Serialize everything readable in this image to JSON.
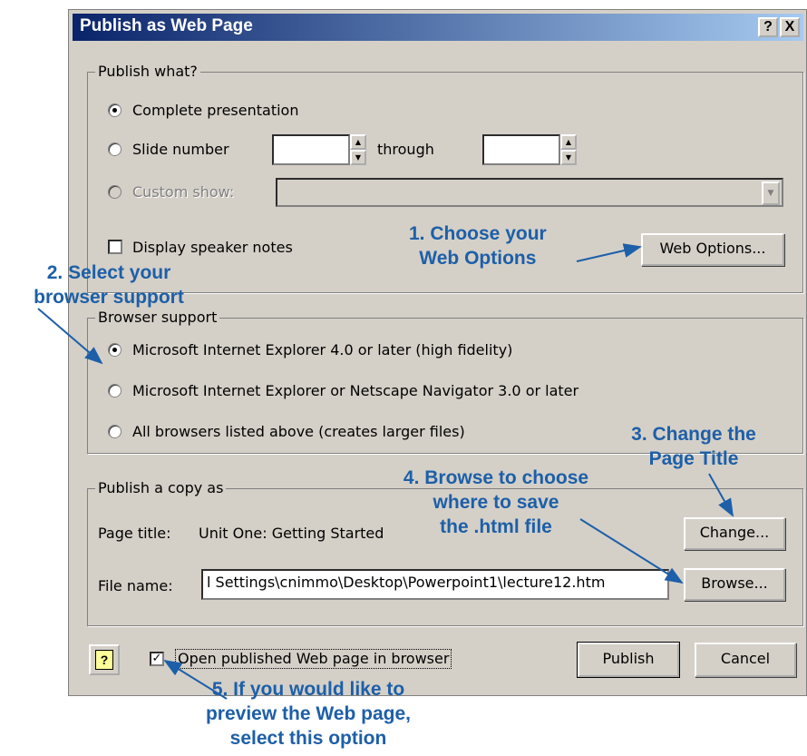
{
  "dialog": {
    "title": "Publish as Web Page",
    "help_button": "?",
    "close_button": "X"
  },
  "publish_what": {
    "legend": "Publish what?",
    "complete_presentation": "Complete presentation",
    "slide_number": "Slide number",
    "slide_from_value": "",
    "through": "through",
    "slide_to_value": "",
    "custom_show": "Custom show:",
    "custom_show_value": "",
    "display_speaker_notes": "Display speaker notes",
    "web_options_button": "Web Options..."
  },
  "browser_support": {
    "legend": "Browser support",
    "option_ie4": "Microsoft Internet Explorer 4.0 or later (high fidelity)",
    "option_ie_netscape": "Microsoft Internet Explorer or Netscape Navigator 3.0 or later",
    "option_all": "All browsers listed above (creates larger files)",
    "selected": "option_ie4"
  },
  "publish_copy": {
    "legend": "Publish a copy as",
    "page_title_label": "Page title:",
    "page_title_value": "Unit One: Getting Started",
    "change_button": "Change...",
    "file_name_label": "File name:",
    "file_name_value": "l Settings\\cnimmo\\Desktop\\Powerpoint1\\lecture12.htm",
    "browse_button": "Browse..."
  },
  "footer": {
    "open_in_browser": "Open published Web page in browser",
    "open_in_browser_checked": true,
    "publish_button": "Publish",
    "cancel_button": "Cancel"
  },
  "annotations": {
    "step1": [
      "1. Choose your",
      "Web Options"
    ],
    "step2": [
      "2. Select your",
      "browser support"
    ],
    "step3": [
      "3. Change the",
      "Page Title"
    ],
    "step4": [
      "4. Browse to choose",
      "where to save",
      "the .html file"
    ],
    "step5": [
      "5. If you would like to",
      "preview the Web page,",
      "select this option"
    ],
    "color": "#1d5fa8"
  }
}
